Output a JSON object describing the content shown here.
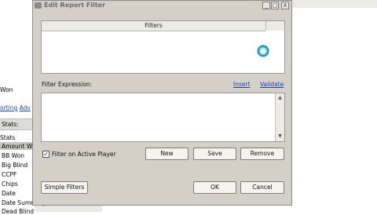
{
  "window": {
    "title": "Edit Report Filter",
    "controls": [
      "_",
      "□",
      "X"
    ]
  },
  "filters_panel": {
    "header": "Filters"
  },
  "expression": {
    "label": "Filter Expression:",
    "insert_link": "Insert",
    "validate_link": "Validate",
    "value": ""
  },
  "active_player": {
    "label": "Filter on Active Player",
    "checked": true,
    "mark": "✓"
  },
  "buttons": {
    "new": "New",
    "save": "Save",
    "remove": "Remove",
    "simple_filters": "Simple Filters",
    "ok": "OK",
    "cancel": "Cancel"
  },
  "scroll_arrows": {
    "up": "▲",
    "down": "▼"
  },
  "background_app": {
    "top_item": "Won",
    "link_a": "orting",
    "link_b": "Adv",
    "stats_header": "Stats:",
    "list_header": "Stats",
    "selected_item": "Amount W",
    "items": [
      "BB Won",
      "Big Blind",
      "CCPF",
      "Chips",
      "Date",
      "Date Summary",
      "Dead Blind"
    ]
  }
}
